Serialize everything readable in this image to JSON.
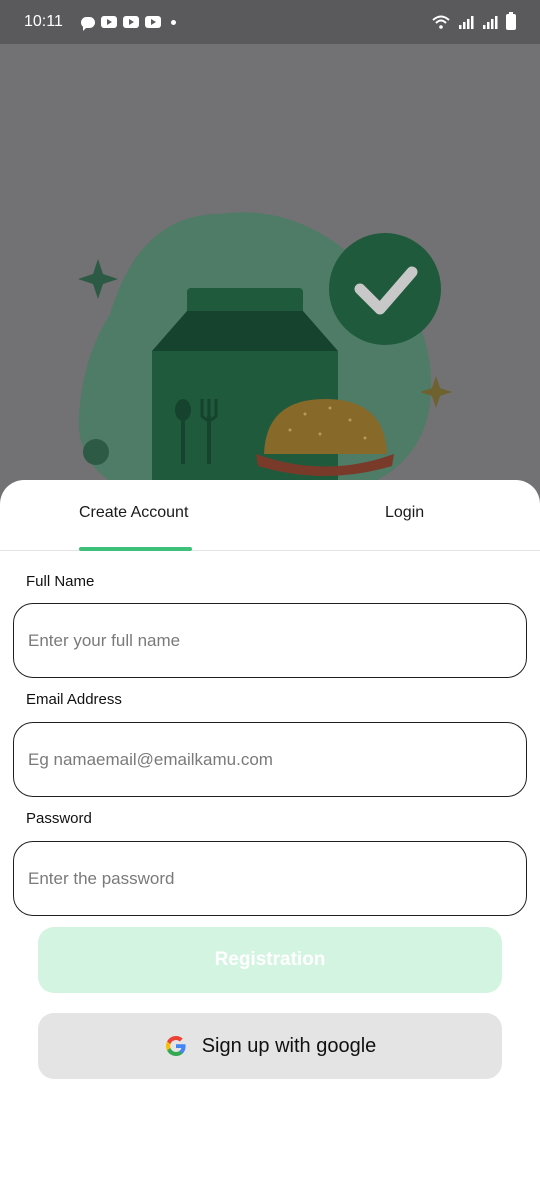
{
  "status_bar": {
    "time": "10:11",
    "notification_icons": [
      "chat-icon",
      "youtube-icon",
      "youtube-icon",
      "youtube-icon"
    ],
    "system_icons": [
      "wifi-icon",
      "signal-icon",
      "signal-icon",
      "battery-icon"
    ]
  },
  "tabs": [
    {
      "label": "Create Account",
      "active": true
    },
    {
      "label": "Login",
      "active": false
    }
  ],
  "form": {
    "full_name": {
      "label": "Full Name",
      "placeholder": "Enter your full name",
      "value": ""
    },
    "email": {
      "label": "Email Address",
      "placeholder": "Eg namaemail@emailkamu.com",
      "value": ""
    },
    "password": {
      "label": "Password",
      "placeholder": "Enter the password",
      "value": ""
    }
  },
  "buttons": {
    "register_label": "Registration",
    "google_label": "Sign up with google"
  },
  "colors": {
    "accent": "#3dc07a",
    "register_disabled_bg": "#d3f4e1",
    "backdrop": "#727174"
  }
}
